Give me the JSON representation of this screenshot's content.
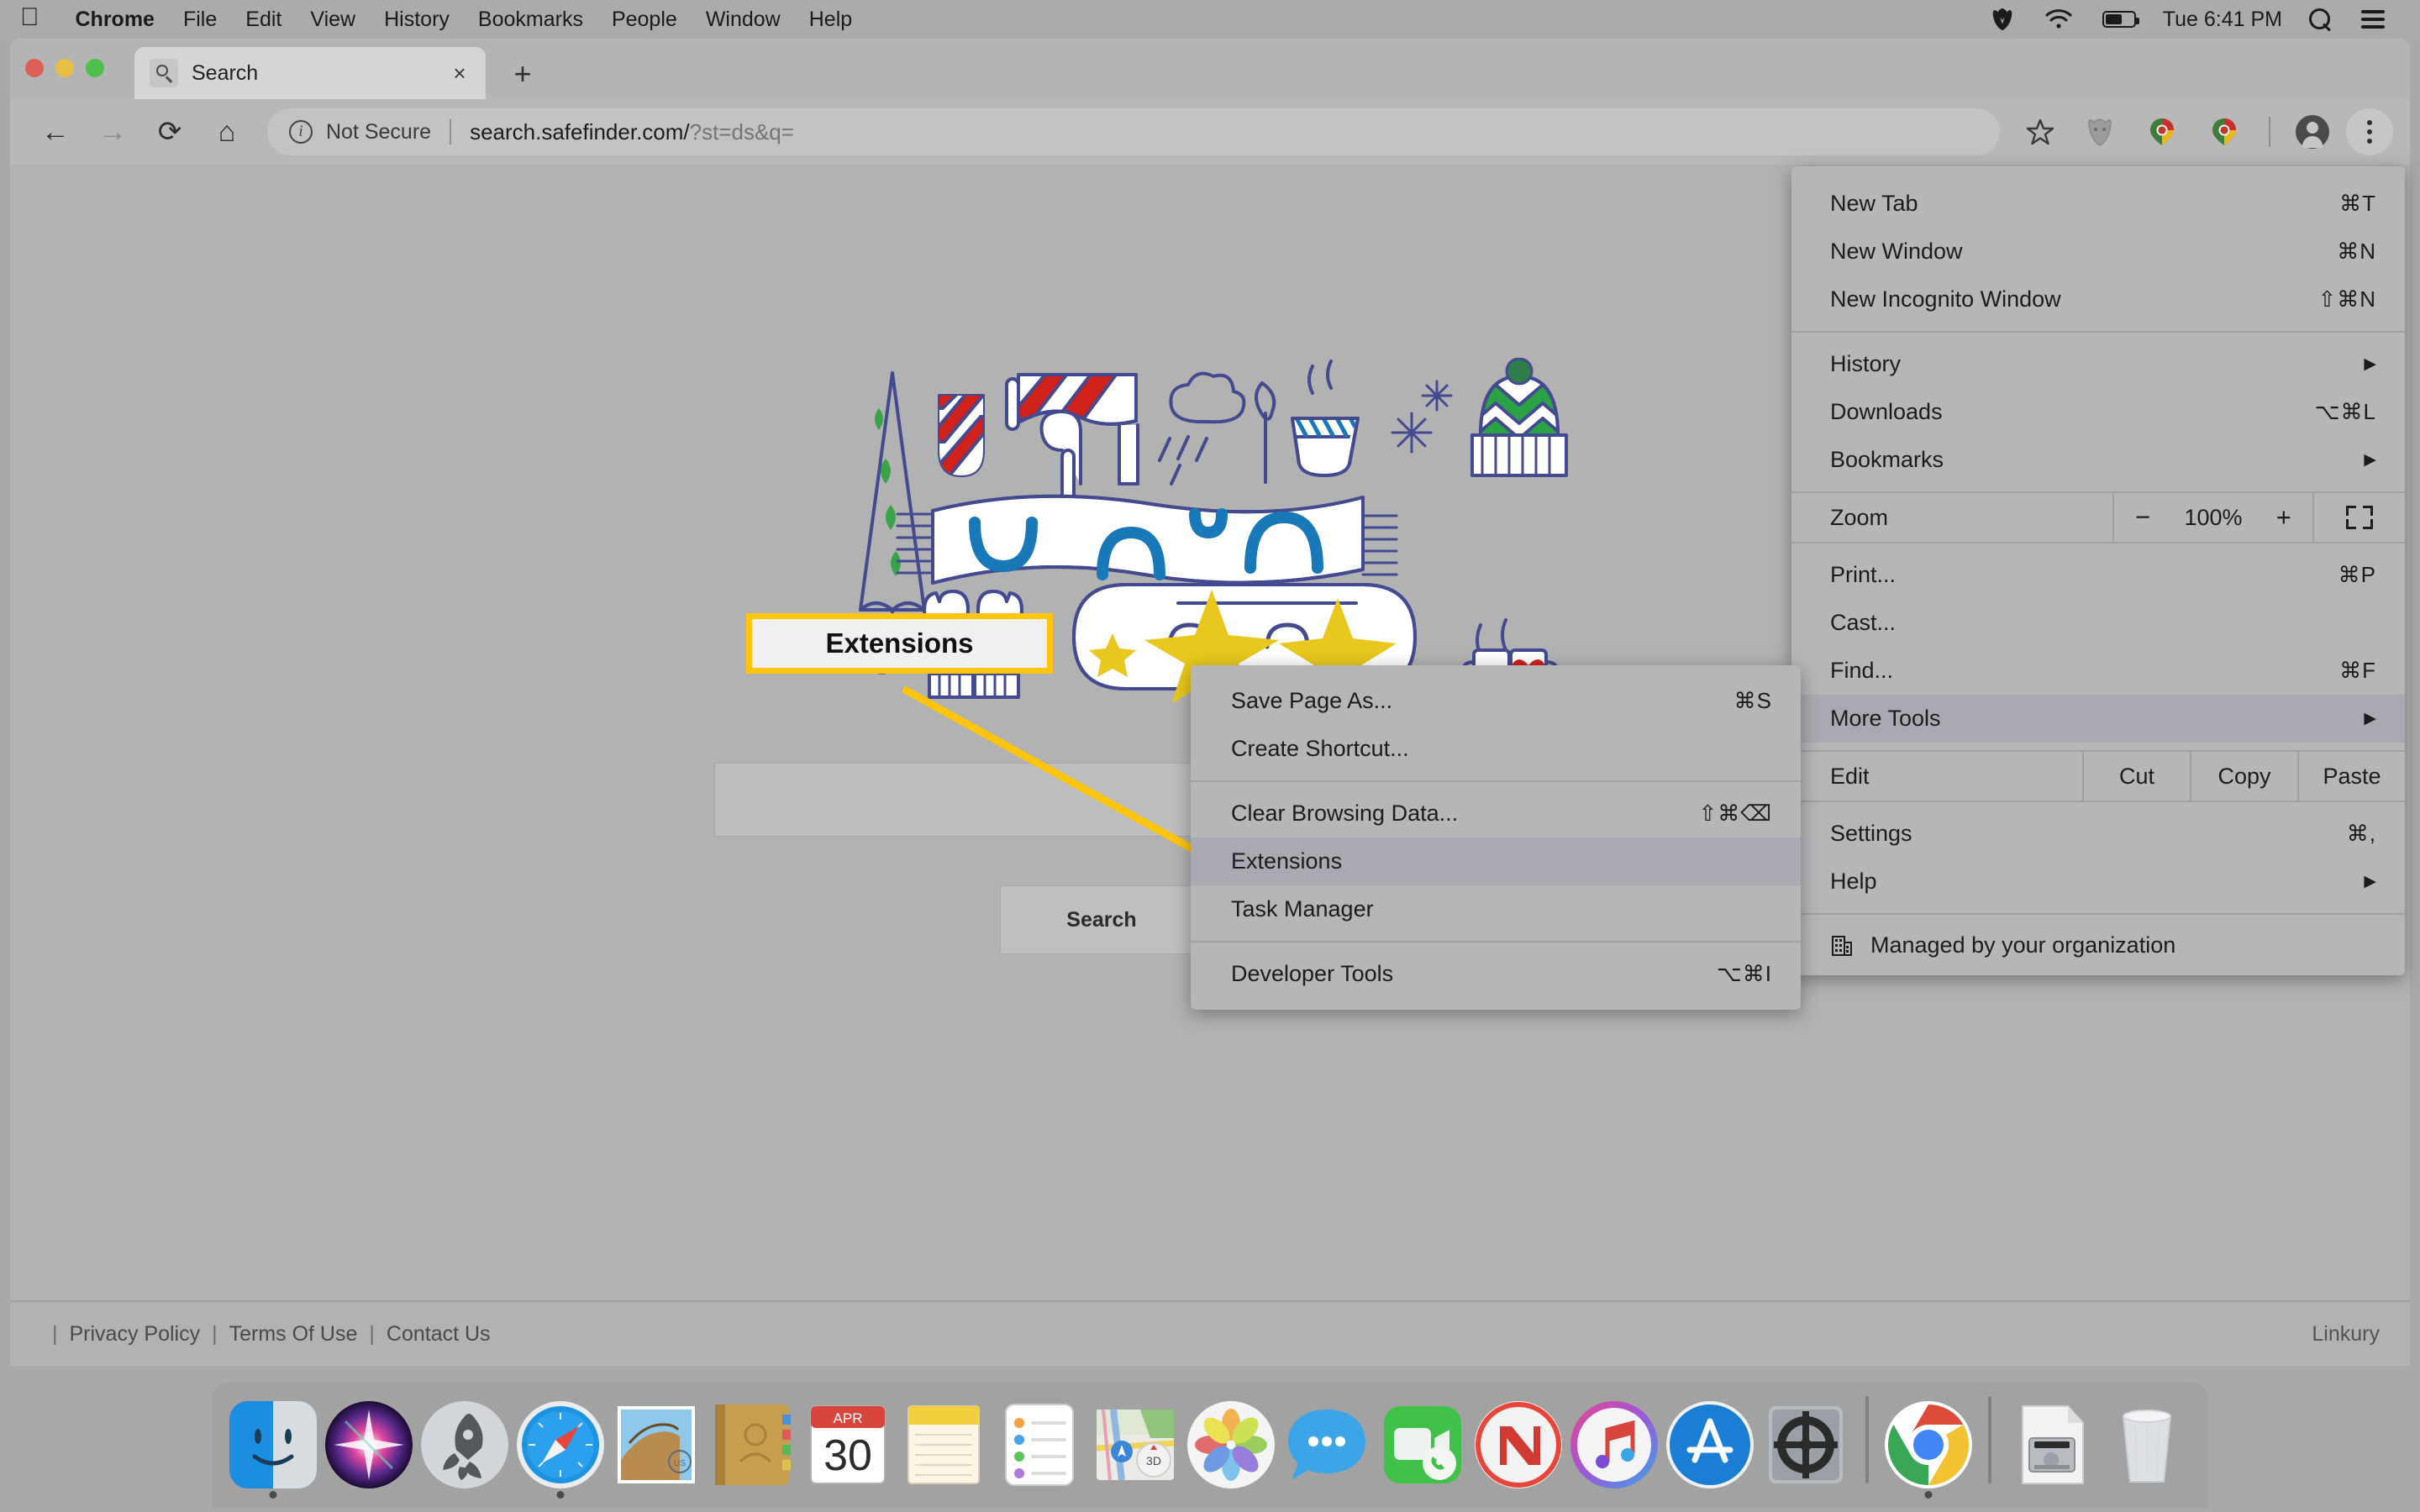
{
  "menubar": {
    "apple_icon": "apple-logo-icon",
    "items": [
      {
        "label": "Chrome",
        "bold": true
      },
      {
        "label": "File",
        "bold": false
      },
      {
        "label": "Edit",
        "bold": false
      },
      {
        "label": "View",
        "bold": false
      },
      {
        "label": "History",
        "bold": false
      },
      {
        "label": "Bookmarks",
        "bold": false
      },
      {
        "label": "People",
        "bold": false
      },
      {
        "label": "Window",
        "bold": false
      },
      {
        "label": "Help",
        "bold": false
      }
    ],
    "status_icons": [
      "malwarebytes-icon",
      "wifi-icon",
      "battery-icon"
    ],
    "clock": "Tue 6:41 PM",
    "right_icons": [
      "spotlight-search-icon",
      "control-center-icon"
    ]
  },
  "browser": {
    "traffic_lights": [
      "close-button",
      "minimize-button",
      "maximize-button"
    ],
    "tab": {
      "favicon": "magnifier-favicon",
      "title": "Search",
      "close": "×"
    },
    "new_tab_label": "+",
    "toolbar": {
      "back": "←",
      "forward": "→",
      "reload": "⟳",
      "home": "⌂",
      "security_label": "Not Secure",
      "url_host": "search.safefinder.com/",
      "url_query": "?st=ds&q=",
      "right_icons": [
        "bookmark-star-icon",
        "extension-shield-icon",
        "extension-chrome-icon-1",
        "extension-chrome-icon-2",
        "profile-avatar",
        "chrome-menu-kebab-icon"
      ]
    }
  },
  "page": {
    "illustration": "winter-doodle-illustration",
    "search_input_value": "",
    "search_button_label": "Search",
    "footer": {
      "links": [
        "Privacy Policy",
        "Terms Of Use",
        "Contact Us"
      ],
      "separator": "|",
      "brand": "Linkury"
    }
  },
  "callout": {
    "label": "Extensions",
    "border_color": "#ffc50d",
    "fill_color": "#f0f0f0",
    "line_color": "#ffc50d"
  },
  "chrome_menu": {
    "groups": [
      {
        "items": [
          {
            "label": "New Tab",
            "accel": "⌘T",
            "arrow": false,
            "highlight": false
          },
          {
            "label": "New Window",
            "accel": "⌘N",
            "arrow": false,
            "highlight": false
          },
          {
            "label": "New Incognito Window",
            "accel": "⇧⌘N",
            "arrow": false,
            "highlight": false
          }
        ]
      },
      {
        "items": [
          {
            "label": "History",
            "accel": "",
            "arrow": true,
            "highlight": false
          },
          {
            "label": "Downloads",
            "accel": "⌥⌘L",
            "arrow": false,
            "highlight": false
          },
          {
            "label": "Bookmarks",
            "accel": "",
            "arrow": true,
            "highlight": false
          }
        ]
      }
    ],
    "zoom_row": {
      "label": "Zoom",
      "minus": "−",
      "level": "100%",
      "plus": "+",
      "fullscreen_icon": "fullscreen-icon"
    },
    "group3": [
      {
        "label": "Print...",
        "accel": "⌘P",
        "arrow": false,
        "highlight": false
      },
      {
        "label": "Cast...",
        "accel": "",
        "arrow": false,
        "highlight": false
      },
      {
        "label": "Find...",
        "accel": "⌘F",
        "arrow": false,
        "highlight": false
      },
      {
        "label": "More Tools",
        "accel": "",
        "arrow": true,
        "highlight": true
      }
    ],
    "edit_row": {
      "label": "Edit",
      "buttons": [
        "Cut",
        "Copy",
        "Paste"
      ]
    },
    "group4": [
      {
        "label": "Settings",
        "accel": "⌘,",
        "arrow": false,
        "highlight": false
      },
      {
        "label": "Help",
        "accel": "",
        "arrow": true,
        "highlight": false
      }
    ],
    "managed": {
      "icon": "organization-building-icon",
      "label": "Managed by your organization"
    }
  },
  "more_tools_submenu": {
    "groups": [
      {
        "items": [
          {
            "label": "Save Page As...",
            "accel": "⌘S",
            "highlight": false
          },
          {
            "label": "Create Shortcut...",
            "accel": "",
            "highlight": false
          }
        ]
      },
      {
        "items": [
          {
            "label": "Clear Browsing Data...",
            "accel": "⇧⌘⌫",
            "highlight": false
          },
          {
            "label": "Extensions",
            "accel": "",
            "highlight": true
          },
          {
            "label": "Task Manager",
            "accel": "",
            "highlight": false
          }
        ]
      },
      {
        "items": [
          {
            "label": "Developer Tools",
            "accel": "⌥⌘I",
            "highlight": false
          }
        ]
      }
    ]
  },
  "dock": {
    "items": [
      {
        "name": "finder",
        "running": true
      },
      {
        "name": "siri",
        "running": false
      },
      {
        "name": "launchpad",
        "running": false
      },
      {
        "name": "safari",
        "running": true
      },
      {
        "name": "mail",
        "running": false
      },
      {
        "name": "contacts",
        "running": false
      },
      {
        "name": "calendar",
        "running": false,
        "month": "APR",
        "day": "30"
      },
      {
        "name": "notes",
        "running": false
      },
      {
        "name": "reminders",
        "running": false
      },
      {
        "name": "maps",
        "running": false
      },
      {
        "name": "photos",
        "running": false
      },
      {
        "name": "messages",
        "running": false
      },
      {
        "name": "facetime",
        "running": false
      },
      {
        "name": "news",
        "running": false
      },
      {
        "name": "itunes",
        "running": false
      },
      {
        "name": "app-store",
        "running": false
      },
      {
        "name": "system-preferences",
        "running": false
      },
      {
        "name": "separator-1",
        "running": false
      },
      {
        "name": "google-chrome",
        "running": true
      },
      {
        "name": "separator-2",
        "running": false
      },
      {
        "name": "disk-image",
        "running": false
      },
      {
        "name": "trash",
        "running": false
      }
    ]
  }
}
